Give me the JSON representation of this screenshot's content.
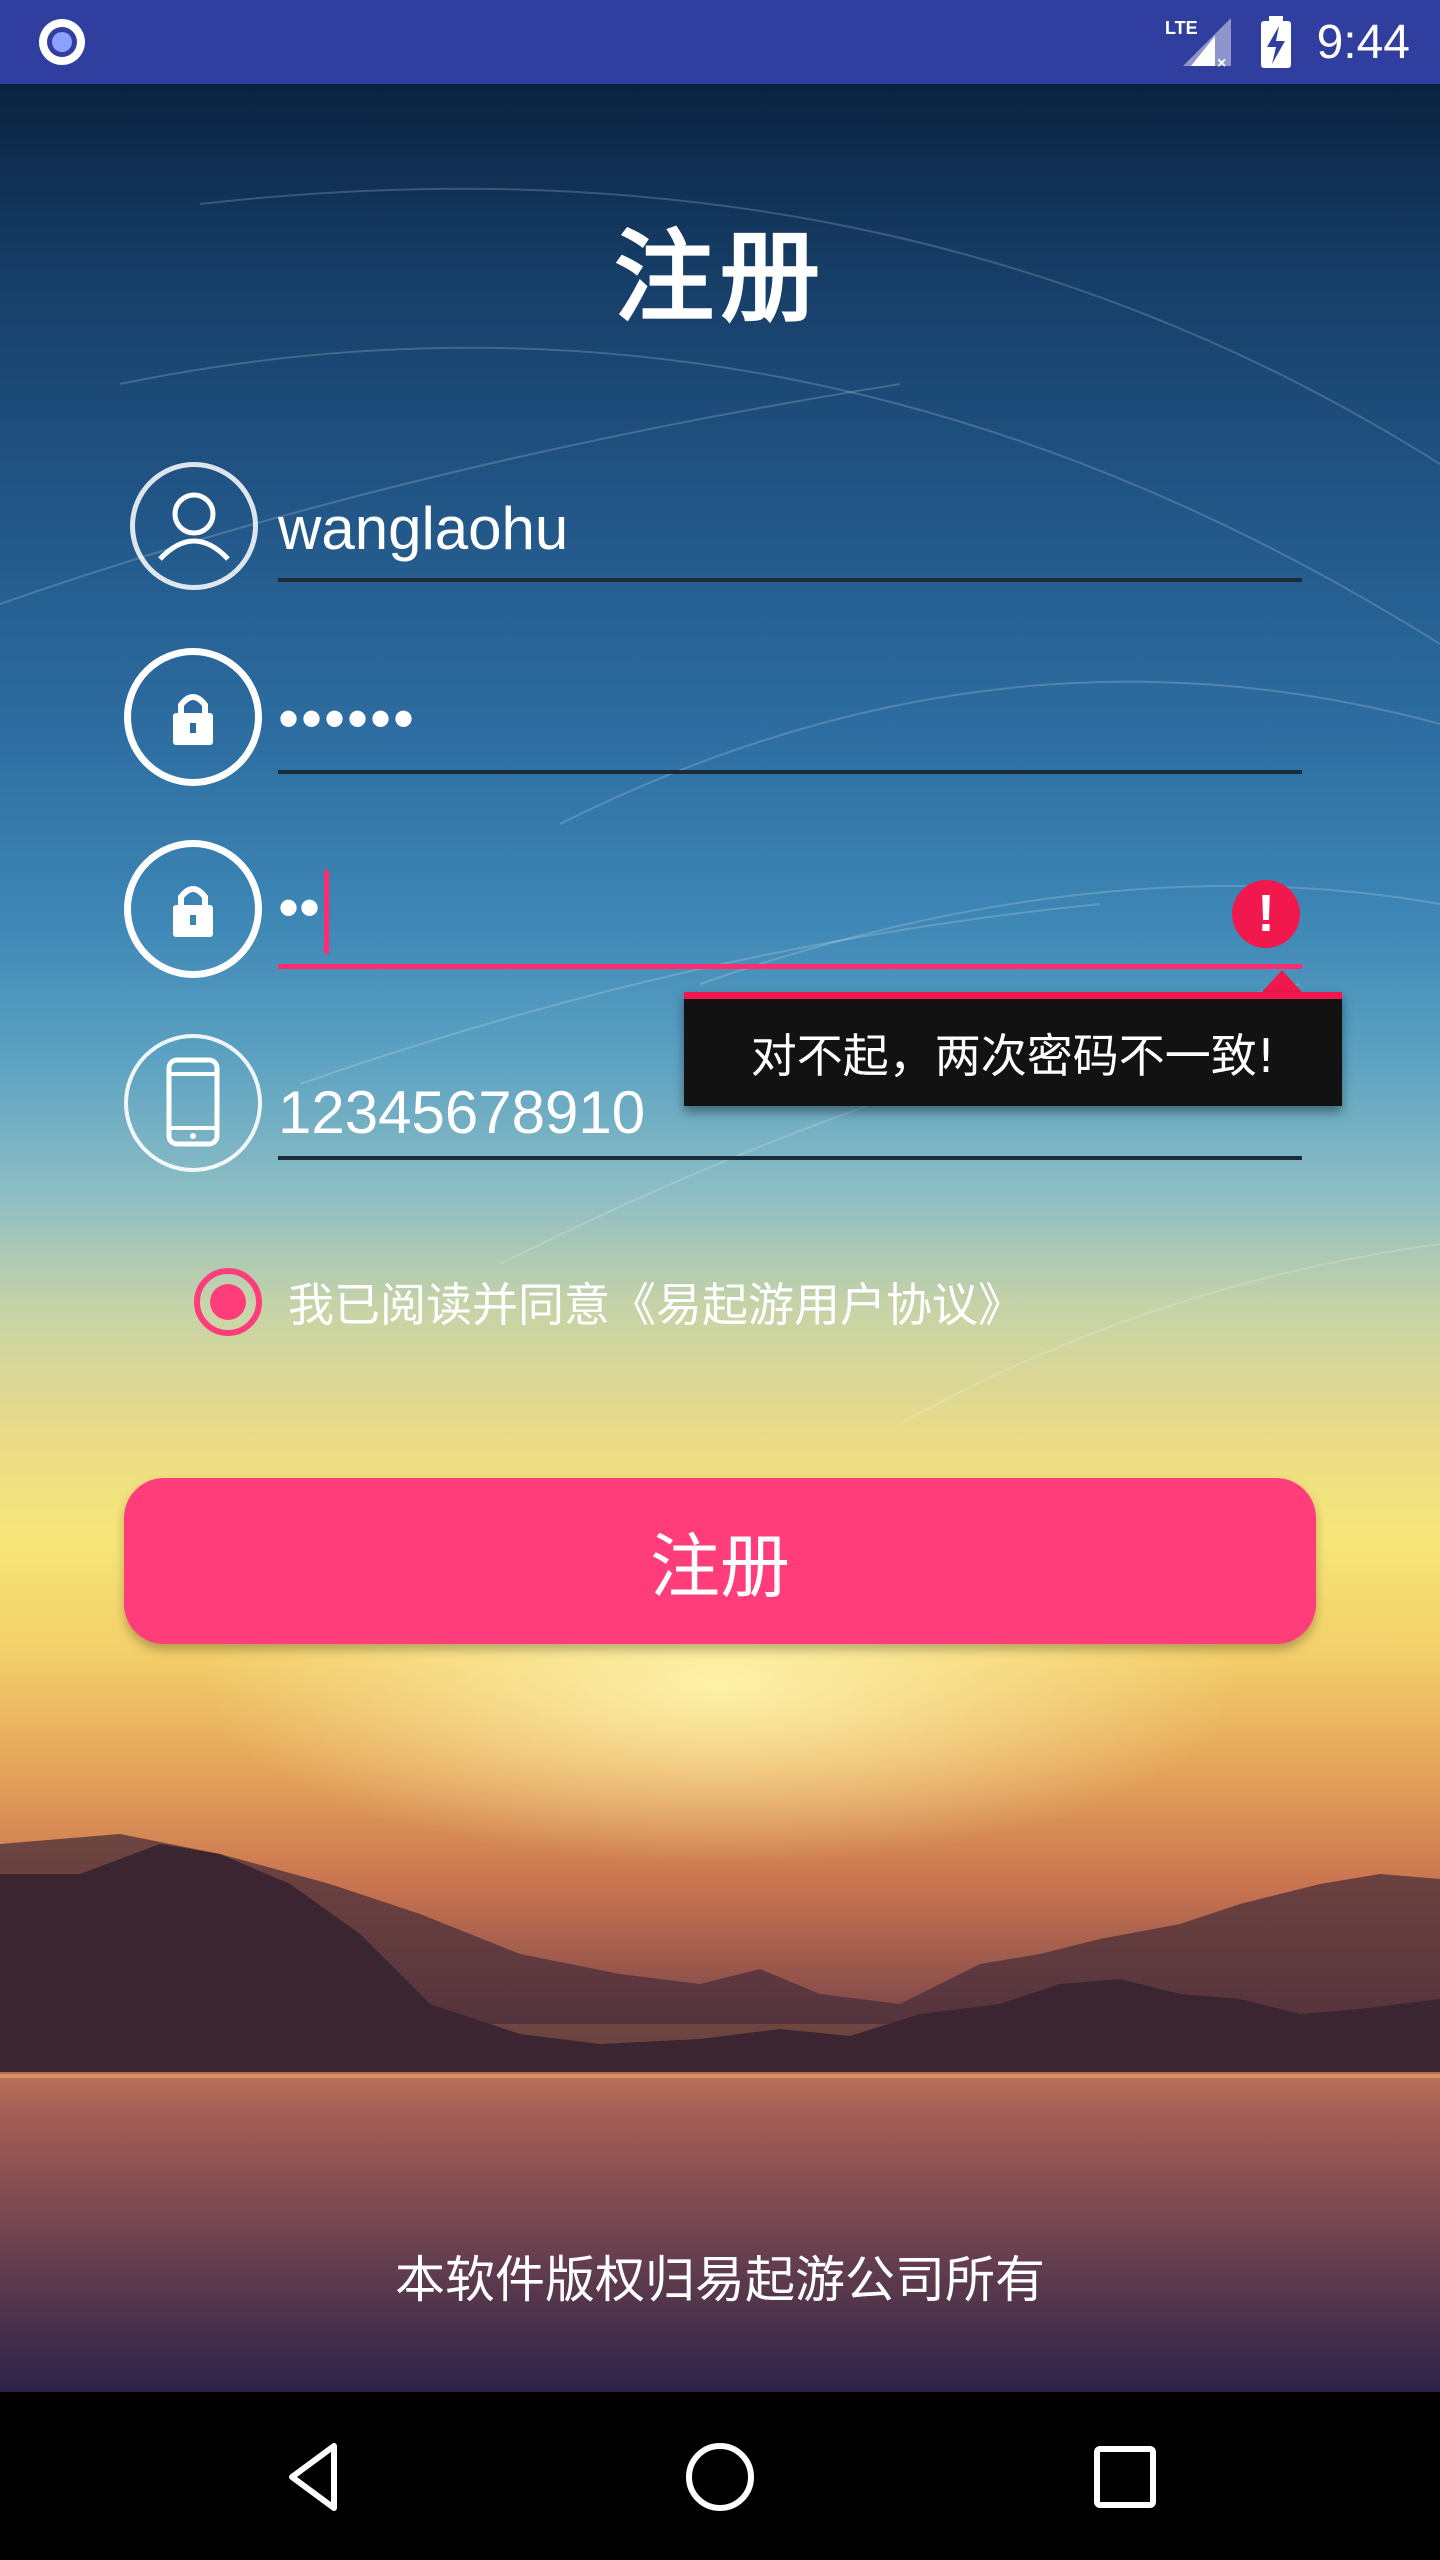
{
  "status_bar": {
    "time": "9:44",
    "left_icon": "record-icon",
    "network_label": "LTE",
    "icons": [
      "signal-icon",
      "battery-charging-icon"
    ]
  },
  "page": {
    "title": "注册"
  },
  "form": {
    "username": {
      "icon": "user-icon",
      "value": "wanglaohu"
    },
    "password": {
      "icon": "lock-icon",
      "value": "••••••"
    },
    "confirm_password": {
      "icon": "lock-icon",
      "value": "••",
      "error_icon": "error-icon",
      "error_message": "对不起，两次密码不一致!"
    },
    "phone": {
      "icon": "phone-icon",
      "value": "12345678910"
    }
  },
  "agreement": {
    "checked": true,
    "label": "我已阅读并同意《易起游用户协议》"
  },
  "register_button": {
    "label": "注册"
  },
  "footer": {
    "copyright": "本软件版权归易起游公司所有"
  },
  "colors": {
    "status_bar": "#303F9F",
    "accent": "#FF3D7A",
    "error": "#F0184C",
    "tooltip_bg": "#121212"
  },
  "nav_bar": {
    "buttons": [
      "back-icon",
      "home-icon",
      "recents-icon"
    ]
  }
}
